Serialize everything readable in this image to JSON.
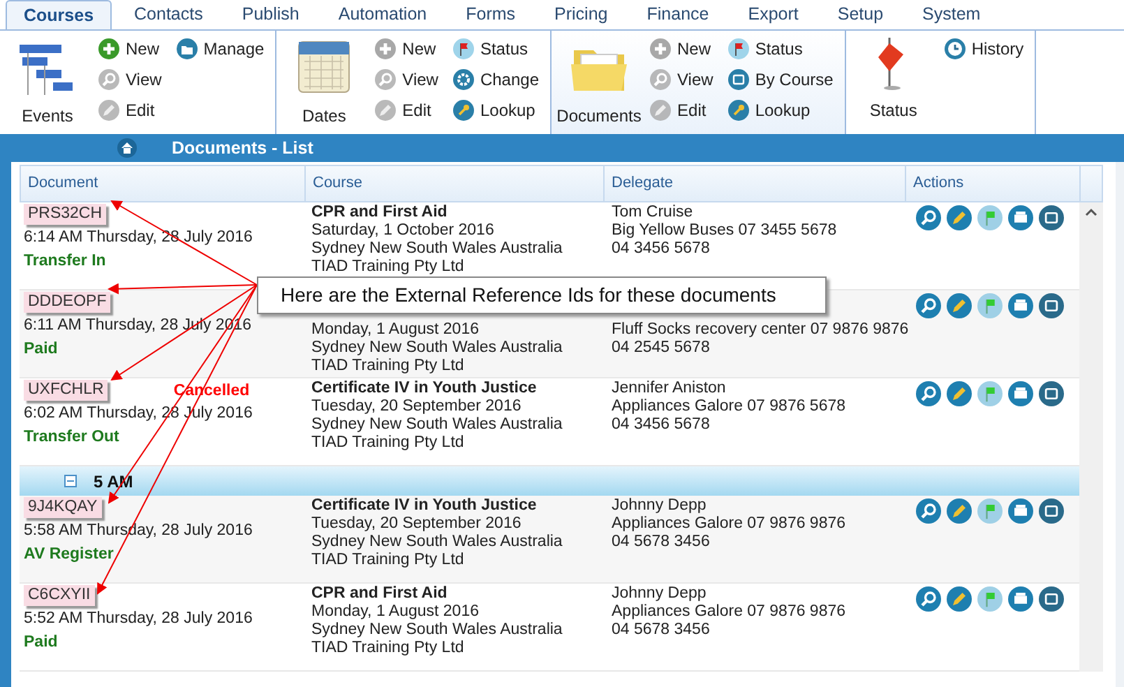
{
  "tabs": [
    {
      "label": "Courses",
      "selected": true
    },
    {
      "label": "Contacts",
      "selected": false
    },
    {
      "label": "Publish",
      "selected": false
    },
    {
      "label": "Automation",
      "selected": false
    },
    {
      "label": "Forms",
      "selected": false
    },
    {
      "label": "Pricing",
      "selected": false
    },
    {
      "label": "Finance",
      "selected": false
    },
    {
      "label": "Export",
      "selected": false
    },
    {
      "label": "Setup",
      "selected": false
    },
    {
      "label": "System",
      "selected": false
    }
  ],
  "ribbon": [
    {
      "label": "Events",
      "kind": "events",
      "highlighted": false,
      "columns": [
        [
          {
            "label": "New",
            "kind": "add",
            "disabled": false
          },
          {
            "label": "View",
            "kind": "view",
            "disabled": true
          },
          {
            "label": "Edit",
            "kind": "edit",
            "disabled": true
          }
        ],
        [
          {
            "label": "Manage",
            "kind": "manage",
            "disabled": false
          }
        ]
      ]
    },
    {
      "label": "Dates",
      "kind": "calendar",
      "highlighted": false,
      "columns": [
        [
          {
            "label": "New",
            "kind": "add",
            "disabled": true
          },
          {
            "label": "View",
            "kind": "view",
            "disabled": true
          },
          {
            "label": "Edit",
            "kind": "edit",
            "disabled": true
          }
        ],
        [
          {
            "label": "Status",
            "kind": "flag",
            "disabled": false
          },
          {
            "label": "Change",
            "kind": "gear",
            "disabled": false
          },
          {
            "label": "Lookup",
            "kind": "key",
            "disabled": false
          }
        ]
      ]
    },
    {
      "label": "Documents",
      "kind": "folder",
      "highlighted": true,
      "columns": [
        [
          {
            "label": "New",
            "kind": "add",
            "disabled": true
          },
          {
            "label": "View",
            "kind": "view",
            "disabled": true
          },
          {
            "label": "Edit",
            "kind": "edit",
            "disabled": true
          }
        ],
        [
          {
            "label": "Status",
            "kind": "flag",
            "disabled": false
          },
          {
            "label": "By Course",
            "kind": "day",
            "disabled": false
          },
          {
            "label": "Lookup",
            "kind": "key",
            "disabled": false
          }
        ]
      ]
    },
    {
      "label": "Status",
      "kind": "bigflag",
      "highlighted": false,
      "columns": [
        [
          {
            "label": "History",
            "kind": "clock",
            "disabled": false
          }
        ]
      ]
    }
  ],
  "title_bar": {
    "title": "Documents - List"
  },
  "table": {
    "columns": [
      "Document",
      "Course",
      "Delegate",
      "Actions"
    ],
    "rows": [
      {
        "ref": "PRS32CH",
        "time": "6:14 AM Thursday, 28 July 2016",
        "status": "Transfer In",
        "course_title": "CPR and First Aid",
        "course_lines": [
          "Saturday, 1 October 2016",
          "Sydney New South Wales Australia",
          "TIAD Training Pty Ltd"
        ],
        "delegate_name": "Tom Cruise",
        "delegate_lines": [
          "Big Yellow Buses 07 3455 5678",
          "04 3456 5678"
        ]
      },
      {
        "ref": "DDDEOPF",
        "time": "6:11 AM Thursday, 28 July 2016",
        "status": "Paid",
        "course_lines": [
          "Monday, 1 August 2016",
          "Sydney New South Wales Australia",
          "TIAD Training Pty Ltd"
        ],
        "delegate_lines": [
          "Fluff Socks recovery center 07 9876 9876",
          "04 2545 5678"
        ]
      },
      {
        "ref": "UXFCHLR",
        "time": "6:02 AM Thursday, 28 July 2016",
        "status": "Transfer Out",
        "note": "Cancelled",
        "course_title": "Certificate IV in Youth Justice",
        "course_lines": [
          "Tuesday, 20 September 2016",
          "Sydney New South Wales Australia",
          "TIAD Training Pty Ltd"
        ],
        "delegate_name": "Jennifer Aniston",
        "delegate_lines": [
          "Appliances Galore 07 9876 5678",
          "04 3456 5678"
        ]
      }
    ],
    "groups": [
      {
        "label": "5 AM",
        "expanded": true,
        "rows": [
          {
            "ref": "9J4KQAY",
            "time": "5:58 AM Thursday, 28 July 2016",
            "status": "AV Register",
            "course_title": "Certificate IV in Youth Justice",
            "course_lines": [
              "Tuesday, 20 September 2016",
              "Sydney New South Wales Australia",
              "TIAD Training Pty Ltd"
            ],
            "delegate_name": "Johnny Depp",
            "delegate_lines": [
              "Appliances Galore 07 9876 9876",
              "04 5678 3456"
            ]
          },
          {
            "ref": "C6CXYII",
            "time": "5:52 AM Thursday, 28 July 2016",
            "status": "Paid",
            "course_title": "CPR and First Aid",
            "course_lines": [
              "Monday, 1 August 2016",
              "Sydney New South Wales Australia",
              "TIAD Training Pty Ltd"
            ],
            "delegate_name": "Johnny Depp",
            "delegate_lines": [
              "Appliances Galore 07 9876 9876",
              "04 5678 3456"
            ]
          }
        ]
      }
    ]
  },
  "callout": {
    "text": "Here are the External Reference Ids for these documents"
  }
}
